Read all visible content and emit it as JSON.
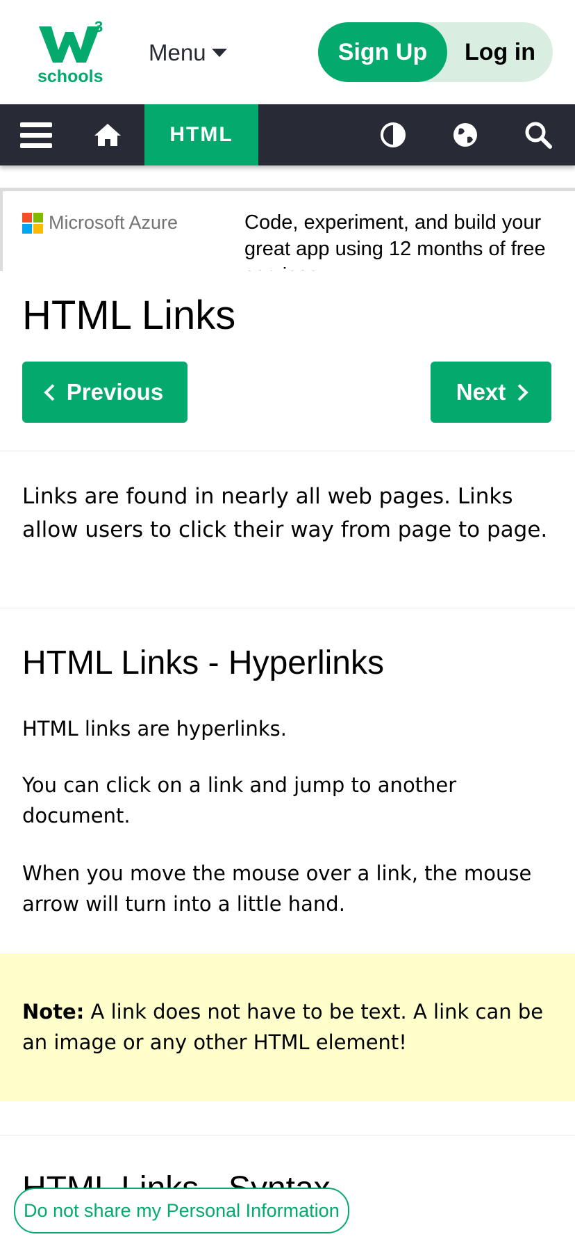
{
  "header": {
    "logo_text": "schools",
    "logo_super": "3",
    "menu_label": "Menu",
    "signup_label": "Sign Up",
    "login_label": "Log in"
  },
  "navbar": {
    "active_tab": "HTML",
    "icons": [
      "hamburger-icon",
      "home-icon",
      "contrast-icon",
      "globe-icon",
      "search-icon"
    ]
  },
  "ad": {
    "brand": "Microsoft Azure",
    "text_line1": "Code, experiment, and build your",
    "text_line2": "great app using 12 months of free",
    "text_line3": "services"
  },
  "main": {
    "title": "HTML Links",
    "prev_label": "Previous",
    "next_label": "Next",
    "intro": "Links are found in nearly all web pages. Links allow users to click their way from page to page.",
    "section1_title": "HTML Links - Hyperlinks",
    "p1": "HTML links are hyperlinks.",
    "p2": "You can click on a link and jump to another document.",
    "p3": "When you move the mouse over a link, the mouse arrow will turn into a little hand.",
    "note_label": "Note:",
    "note_text": " A link does not have to be text. A link can be an image or any other HTML element!",
    "section2_title": "HTML Links - Syntax"
  },
  "privacy_label": "Do not share my Personal Information",
  "colors": {
    "brand_green": "#04aa6d",
    "nav_dark": "#282a35",
    "note_bg": "#ffffcc"
  }
}
